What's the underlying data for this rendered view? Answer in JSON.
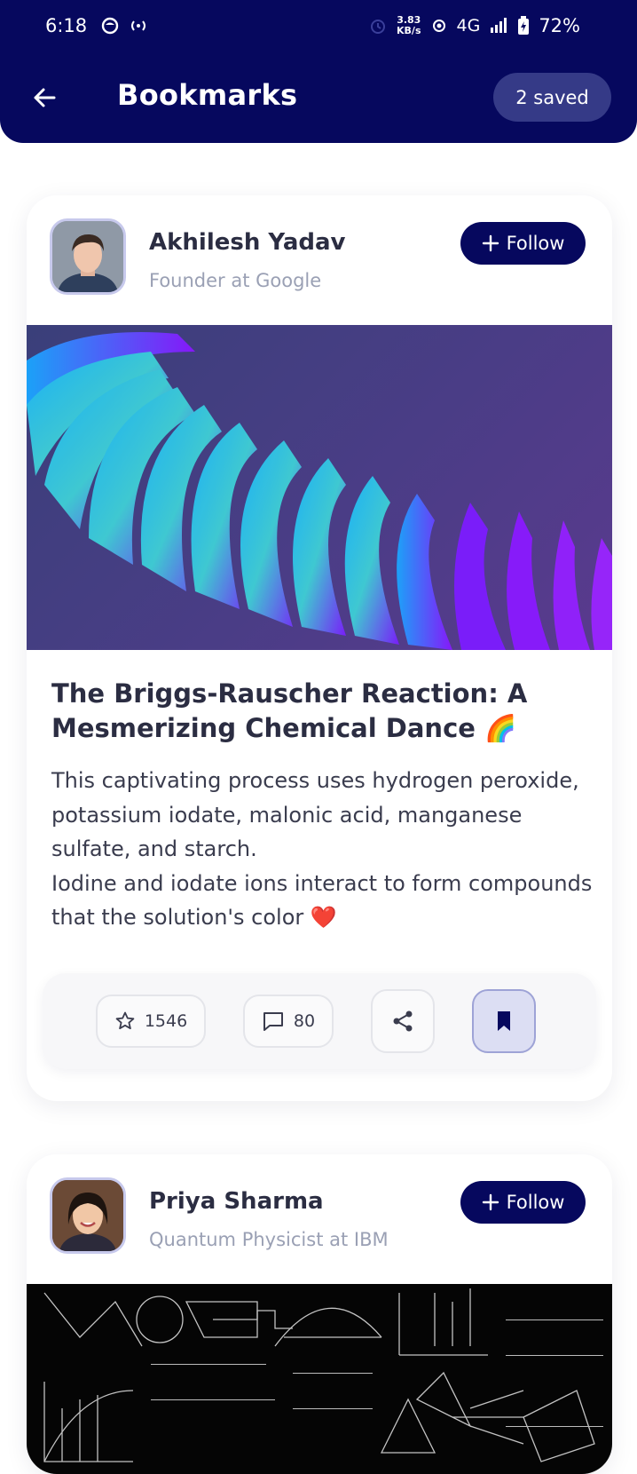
{
  "status_bar": {
    "time": "6:18",
    "net_speed_value": "3.83",
    "net_speed_unit": "KB/s",
    "network": "4G",
    "battery": "72%"
  },
  "header": {
    "title": "Bookmarks",
    "saved_count": "2 saved"
  },
  "posts": [
    {
      "author": "Akhilesh Yadav",
      "role": "Founder at Google",
      "follow_label": "Follow",
      "title": "The Briggs-Rauscher Reaction: A Mesmerizing Chemical Dance 🌈",
      "body": "This captivating process uses hydrogen peroxide, potassium iodate, malonic acid, manganese sulfate, and starch.\nIodine and iodate ions interact to form compounds that the solution's color ❤️",
      "likes": "1546",
      "comments": "80",
      "bookmarked": true
    },
    {
      "author": "Priya Sharma",
      "role": "Quantum Physicist at IBM",
      "follow_label": "Follow"
    }
  ],
  "colors": {
    "header_bg": "#06085e",
    "saved_pill_bg": "#353a87",
    "follow_bg": "#06085e",
    "bookmark_active_bg": "#dcdef3"
  },
  "icons": [
    "back-arrow-icon",
    "star-icon",
    "comment-icon",
    "share-icon",
    "bookmark-icon",
    "plus-icon"
  ]
}
